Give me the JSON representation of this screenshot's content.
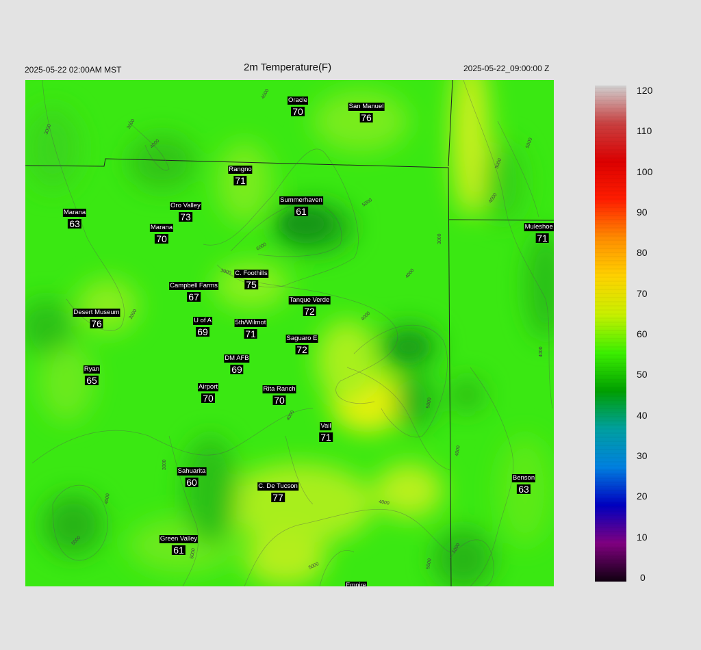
{
  "header": {
    "valid_time_local": "2025-05-22 02:00AM MST",
    "title": "2m Temperature(F)",
    "valid_time_utc": "2025-05-22_09:00:00 Z"
  },
  "stations": [
    {
      "name": "Oracle",
      "temp": "70"
    },
    {
      "name": "San Manuel",
      "temp": "76"
    },
    {
      "name": "Rangno",
      "temp": "71"
    },
    {
      "name": "Summerhaven",
      "temp": "61"
    },
    {
      "name": "Oro Valley",
      "temp": "73"
    },
    {
      "name": "Marana",
      "temp": "63"
    },
    {
      "name": "Marana",
      "temp": "70"
    },
    {
      "name": "Muleshoe R",
      "temp": "71"
    },
    {
      "name": "C. Foothills",
      "temp": "75"
    },
    {
      "name": "Campbell Farms",
      "temp": "67"
    },
    {
      "name": "Tanque Verde",
      "temp": "72"
    },
    {
      "name": "Desert Museum",
      "temp": "76"
    },
    {
      "name": "U of A",
      "temp": "69"
    },
    {
      "name": "5th/Wilmot",
      "temp": "71"
    },
    {
      "name": "Saguaro E",
      "temp": "72"
    },
    {
      "name": "DM AFB",
      "temp": "69"
    },
    {
      "name": "Ryan",
      "temp": "65"
    },
    {
      "name": "Airport",
      "temp": "70"
    },
    {
      "name": "Rita Ranch",
      "temp": "70"
    },
    {
      "name": "Vail",
      "temp": "71"
    },
    {
      "name": "Sahuarita",
      "temp": "60"
    },
    {
      "name": "C. De Tucson",
      "temp": "77"
    },
    {
      "name": "Benson",
      "temp": "63"
    },
    {
      "name": "Green Valley",
      "temp": "61"
    },
    {
      "name": "Empire",
      "temp": ""
    }
  ],
  "contour_labels": [
    "3000",
    "4000",
    "5000",
    "6000"
  ],
  "colorbar": {
    "units": "F",
    "ticks": [
      "120",
      "110",
      "100",
      "90",
      "80",
      "70",
      "60",
      "50",
      "40",
      "30",
      "20",
      "10",
      "0"
    ],
    "colors": [
      "#d0d0d0",
      "#c84040",
      "#dc0000",
      "#ff1e00",
      "#ff8c00",
      "#ffd200",
      "#c8f000",
      "#3cf000",
      "#00a000",
      "#00a0a0",
      "#0080e0",
      "#0000c0",
      "#800080",
      "#100010"
    ]
  }
}
